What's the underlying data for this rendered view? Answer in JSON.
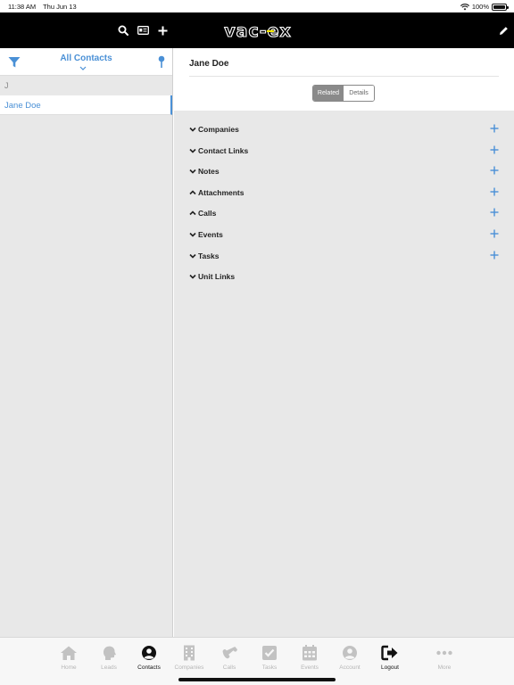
{
  "status_bar": {
    "time": "11:38 AM",
    "date": "Thu Jun 13",
    "battery": "100%",
    "battery_level": 1.0
  },
  "header": {
    "logo_text": "vac-ex",
    "icons": [
      "search-icon",
      "card-icon",
      "plus-icon",
      "pencil-icon"
    ],
    "accent_color": "#f2e600"
  },
  "contacts_panel": {
    "filter_label": "All Contacts",
    "section_letter": "J",
    "contacts": [
      "Jane Doe"
    ],
    "accent_color": "#4a90d6"
  },
  "detail": {
    "title": "Jane Doe",
    "segments": [
      "Related",
      "Details"
    ],
    "active_segment": "Related",
    "sections": [
      {
        "label": "Companies",
        "state": "collapsed",
        "addable": true
      },
      {
        "label": "Contact Links",
        "state": "collapsed",
        "addable": true
      },
      {
        "label": "Notes",
        "state": "collapsed",
        "addable": true
      },
      {
        "label": "Attachments",
        "state": "expanded",
        "addable": true
      },
      {
        "label": "Calls",
        "state": "expanded",
        "addable": true
      },
      {
        "label": "Events",
        "state": "collapsed",
        "addable": true
      },
      {
        "label": "Tasks",
        "state": "collapsed",
        "addable": true
      },
      {
        "label": "Unit Links",
        "state": "collapsed",
        "addable": false
      }
    ]
  },
  "tab_bar": {
    "tabs": [
      {
        "label": "Home",
        "icon": "house-icon"
      },
      {
        "label": "Leads",
        "icon": "head-icon"
      },
      {
        "label": "Contacts",
        "icon": "person-circle-icon"
      },
      {
        "label": "Companies",
        "icon": "building-icon"
      },
      {
        "label": "Calls",
        "icon": "phone-icon"
      },
      {
        "label": "Tasks",
        "icon": "checkbox-icon"
      },
      {
        "label": "Events",
        "icon": "calendar-icon"
      },
      {
        "label": "Account",
        "icon": "account-icon"
      },
      {
        "label": "Logout",
        "icon": "logout-icon"
      },
      {
        "label": "More",
        "icon": "more-dots-icon"
      }
    ],
    "active_tabs": [
      "Contacts",
      "Logout"
    ]
  }
}
